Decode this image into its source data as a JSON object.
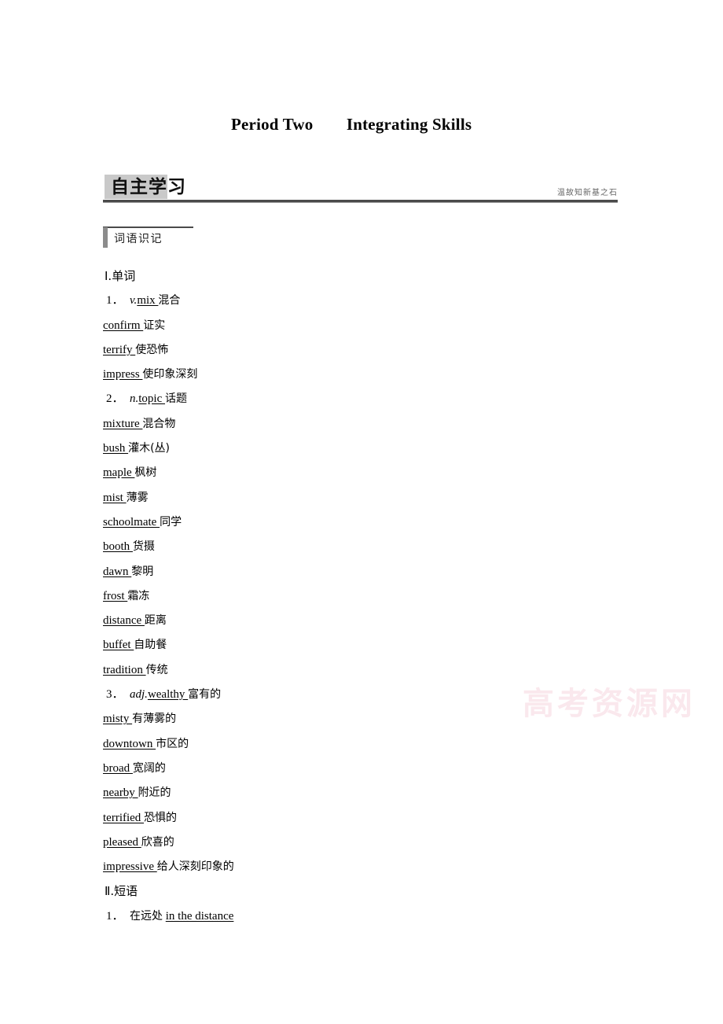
{
  "document": {
    "title": "Period Two　　Integrating Skills"
  },
  "banner": {
    "title": "自主学习",
    "subtitle": "温故知新基之石"
  },
  "subsection": {
    "title": "词语识记"
  },
  "sections": [
    {
      "heading": "Ⅰ.单词",
      "entries": [
        {
          "num": "1．",
          "pos": "v.",
          "en": "mix",
          "cn": "混合"
        },
        {
          "num": "",
          "pos": "",
          "en": "confirm",
          "cn": "证实"
        },
        {
          "num": "",
          "pos": "",
          "en": "terrify",
          "cn": "使恐怖"
        },
        {
          "num": "",
          "pos": "",
          "en": "impress",
          "cn": "使印象深刻"
        },
        {
          "num": "2．",
          "pos": "n.",
          "en": "topic",
          "cn": "话题"
        },
        {
          "num": "",
          "pos": "",
          "en": "mixture",
          "cn": "混合物"
        },
        {
          "num": "",
          "pos": "",
          "en": "bush",
          "cn": "灌木(丛)"
        },
        {
          "num": "",
          "pos": "",
          "en": "maple",
          "cn": "枫树"
        },
        {
          "num": "",
          "pos": "",
          "en": "mist",
          "cn": "薄雾"
        },
        {
          "num": "",
          "pos": "",
          "en": "schoolmate",
          "cn": "同学"
        },
        {
          "num": "",
          "pos": "",
          "en": "booth",
          "cn": "货摄"
        },
        {
          "num": "",
          "pos": "",
          "en": "dawn",
          "cn": "黎明"
        },
        {
          "num": "",
          "pos": "",
          "en": "frost",
          "cn": "霜冻"
        },
        {
          "num": "",
          "pos": "",
          "en": "distance",
          "cn": "距离"
        },
        {
          "num": "",
          "pos": "",
          "en": "buffet",
          "cn": "自助餐"
        },
        {
          "num": "",
          "pos": "",
          "en": "tradition",
          "cn": "传统"
        },
        {
          "num": "3．",
          "pos": "adj.",
          "en": "wealthy",
          "cn": "富有的"
        },
        {
          "num": "",
          "pos": "",
          "en": "misty",
          "cn": "有薄雾的"
        },
        {
          "num": "",
          "pos": "",
          "en": "downtown",
          "cn": "市区的"
        },
        {
          "num": "",
          "pos": "",
          "en": "broad",
          "cn": "宽阔的"
        },
        {
          "num": "",
          "pos": "",
          "en": "nearby",
          "cn": "附近的"
        },
        {
          "num": "",
          "pos": "",
          "en": "terrified",
          "cn": "恐惧的"
        },
        {
          "num": "",
          "pos": "",
          "en": "pleased",
          "cn": "欣喜的"
        },
        {
          "num": "",
          "pos": "",
          "en": "impressive",
          "cn": "给人深刻印象的"
        }
      ]
    },
    {
      "heading": "Ⅱ.短语",
      "phrases": [
        {
          "num": "1．",
          "cn": "在远处",
          "en": "in the distance"
        }
      ]
    }
  ],
  "watermark": {
    "text": "高考资源网"
  }
}
